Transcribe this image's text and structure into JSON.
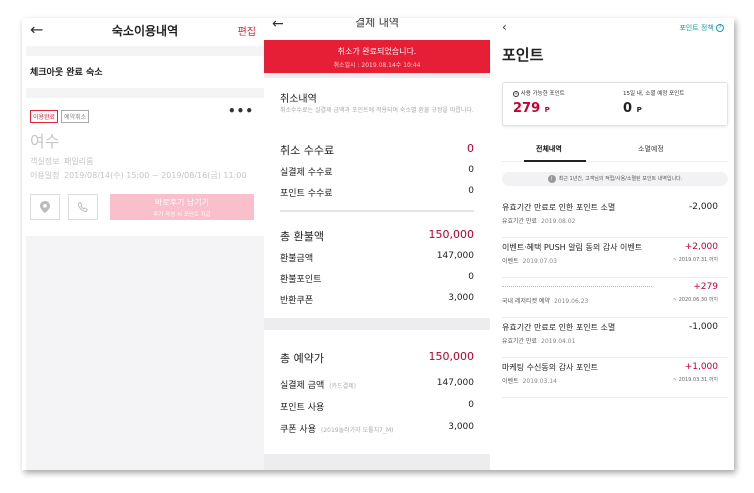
{
  "panel1": {
    "back_icon": "left-arrow-icon",
    "title": "숙소이용내역",
    "edit": "편집",
    "section": "체크아웃 완료 숙소",
    "badges": [
      "이용완료",
      "예약취소"
    ],
    "more": "•••",
    "city": "여수",
    "room_label": "객실정보",
    "room": "패밀리룸",
    "dates_label": "이용일정",
    "dates": "2019/08/14(수) 15:00 ~ 2019/08/16(금) 11:00",
    "review_button": "바로후기 남기기",
    "review_sub": "후기 작성 시 포인트 지급"
  },
  "panel2": {
    "back_icon": "left-arrow-icon",
    "title": "결제 내역",
    "banner_title": "취소가 완료되었습니다.",
    "banner_sub": "취소일시 : 2019.08.14수 10:44",
    "cancel_section": "취소내역",
    "cancel_desc": "취소수수료는 실결제 금액과 포인트에 적용되며 숙소별 환불 규정을 따릅니다.",
    "cancel_fee_label": "취소 수수료",
    "cancel_fee": "0",
    "real_fee_label": "실결제 수수료",
    "real_fee": "0",
    "point_fee_label": "포인트 수수료",
    "point_fee": "0",
    "refund_total_label": "총 환불액",
    "refund_total": "150,000",
    "refund_amount_label": "환불금액",
    "refund_amount": "147,000",
    "refund_point_label": "환불포인트",
    "refund_point": "0",
    "return_coupon_label": "반환쿠폰",
    "return_coupon": "3,000",
    "booking_total_label": "총 예약가",
    "booking_total": "150,000",
    "paid_label": "실결제 금액",
    "paid_sub": "(카드결제)",
    "paid": "147,000",
    "point_use_label": "포인트 사용",
    "point_use": "0",
    "coupon_use_label": "쿠폰 사용",
    "coupon_use_sub": "(2019놀러가자 도톨치7_M)",
    "coupon_use": "3,000"
  },
  "panel3": {
    "back_icon": "left-chevron-icon",
    "policy": "포인트 정책",
    "title": "포인트",
    "available_label": "사용 가능한 포인트",
    "available": "279",
    "available_unit": "P",
    "expire_label": "15일 내, 소멸 예정 포인트",
    "expire": "0",
    "expire_unit": "P",
    "tab_all": "전체내역",
    "tab_expire": "소멸예정",
    "notice": "최근 1년간, 고객님의 적립/사용/소멸된 포인트 내역입니다.",
    "items": [
      {
        "name": "유효기간 만료로 인한 포인트 소멸",
        "type": "유효기간 만료",
        "date": "2019.08.02",
        "amount": "-2,000",
        "expire": ""
      },
      {
        "name": "이벤트·혜택 PUSH 알림 동의 감사 이벤트",
        "type": "이벤트",
        "date": "2019.07.03",
        "amount": "+2,000",
        "expire": "~ 2019.07.31 까지"
      },
      {
        "name": "",
        "type": "국내 레저티켓 예약",
        "date": "2019.06.23",
        "amount": "+279",
        "expire": "~ 2020.06.30 까지"
      },
      {
        "name": "유효기간 만료로 인한 포인트 소멸",
        "type": "유효기간 만료",
        "date": "2019.04.01",
        "amount": "-1,000",
        "expire": ""
      },
      {
        "name": "마케팅 수신동의 감사 포인트",
        "type": "이벤트",
        "date": "2019.03.14",
        "amount": "+1,000",
        "expire": "~ 2019.03.31 까지"
      }
    ]
  }
}
